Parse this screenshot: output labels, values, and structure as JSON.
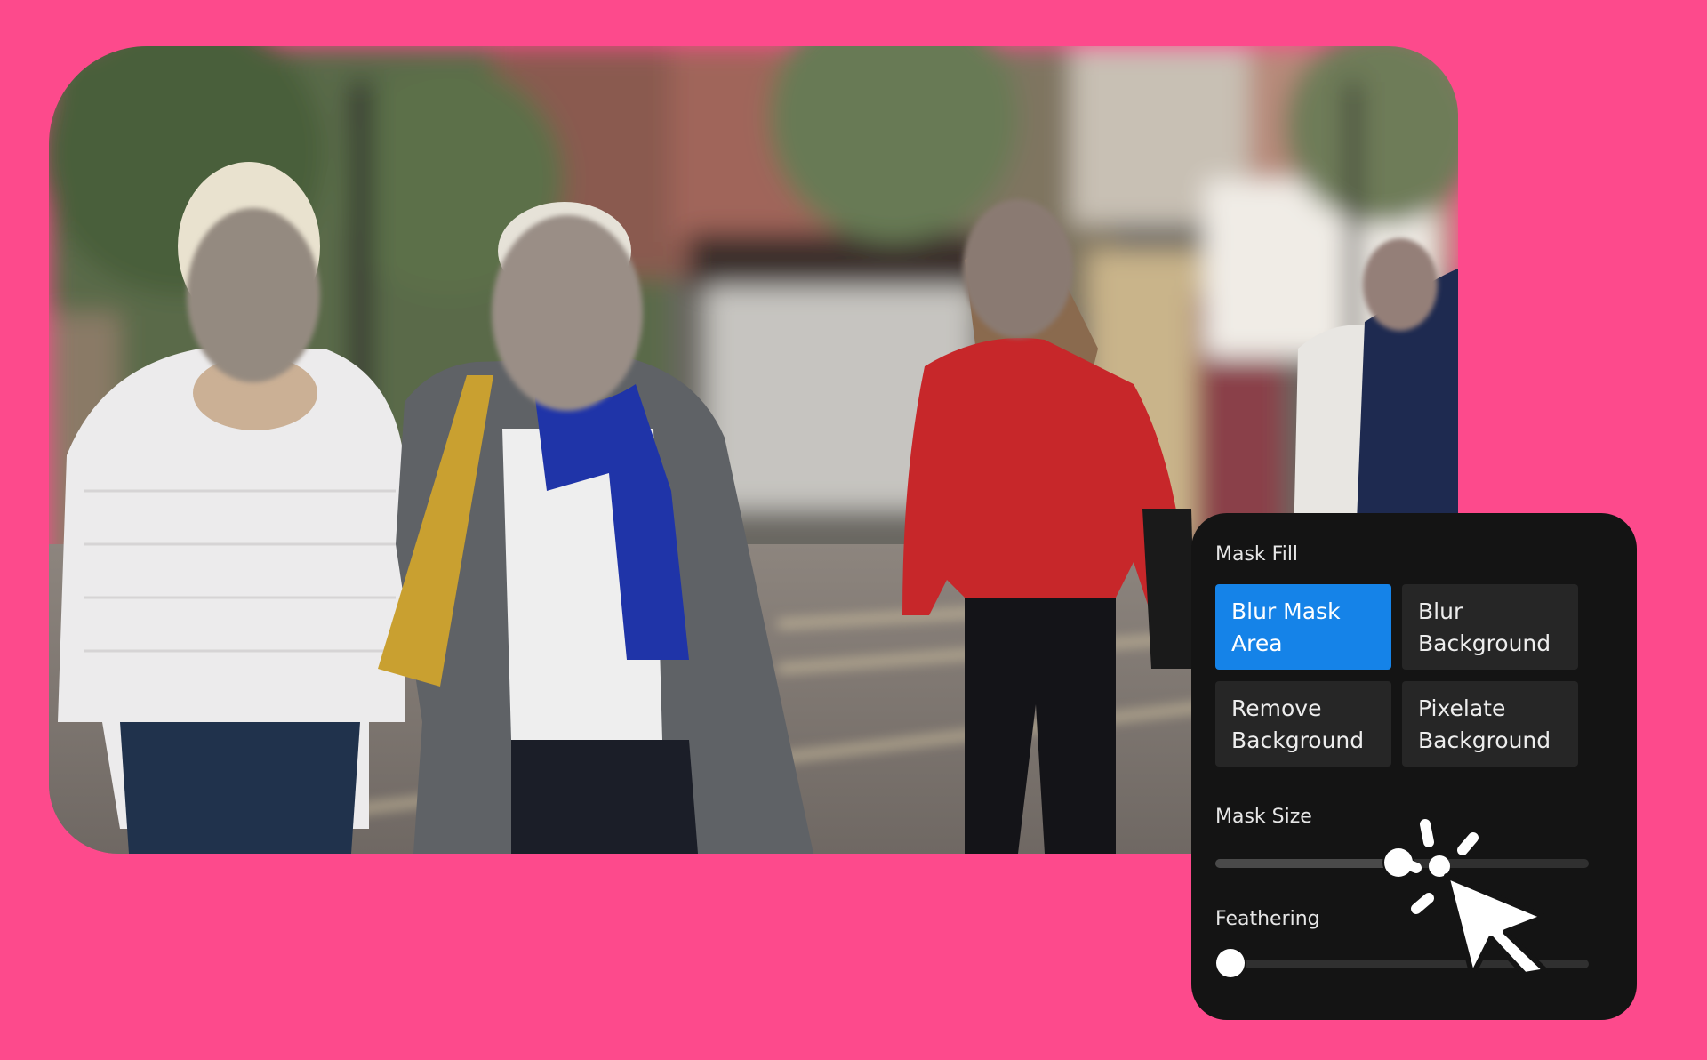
{
  "panel": {
    "mask_fill_label": "Mask Fill",
    "options": [
      {
        "label": "Blur Mask Area",
        "active": true
      },
      {
        "label": "Blur Background",
        "active": false
      },
      {
        "label": "Remove Background",
        "active": false
      },
      {
        "label": "Pixelate Background",
        "active": false
      }
    ],
    "mask_size_label": "Mask Size",
    "mask_size_value": 0.49,
    "feathering_label": "Feathering",
    "feathering_value": 0.04
  },
  "colors": {
    "background": "#fd4a8c",
    "panel": "#141414",
    "accent": "#1583e8"
  },
  "icons": [
    "pointer-cursor-icon",
    "click-burst-icon"
  ]
}
